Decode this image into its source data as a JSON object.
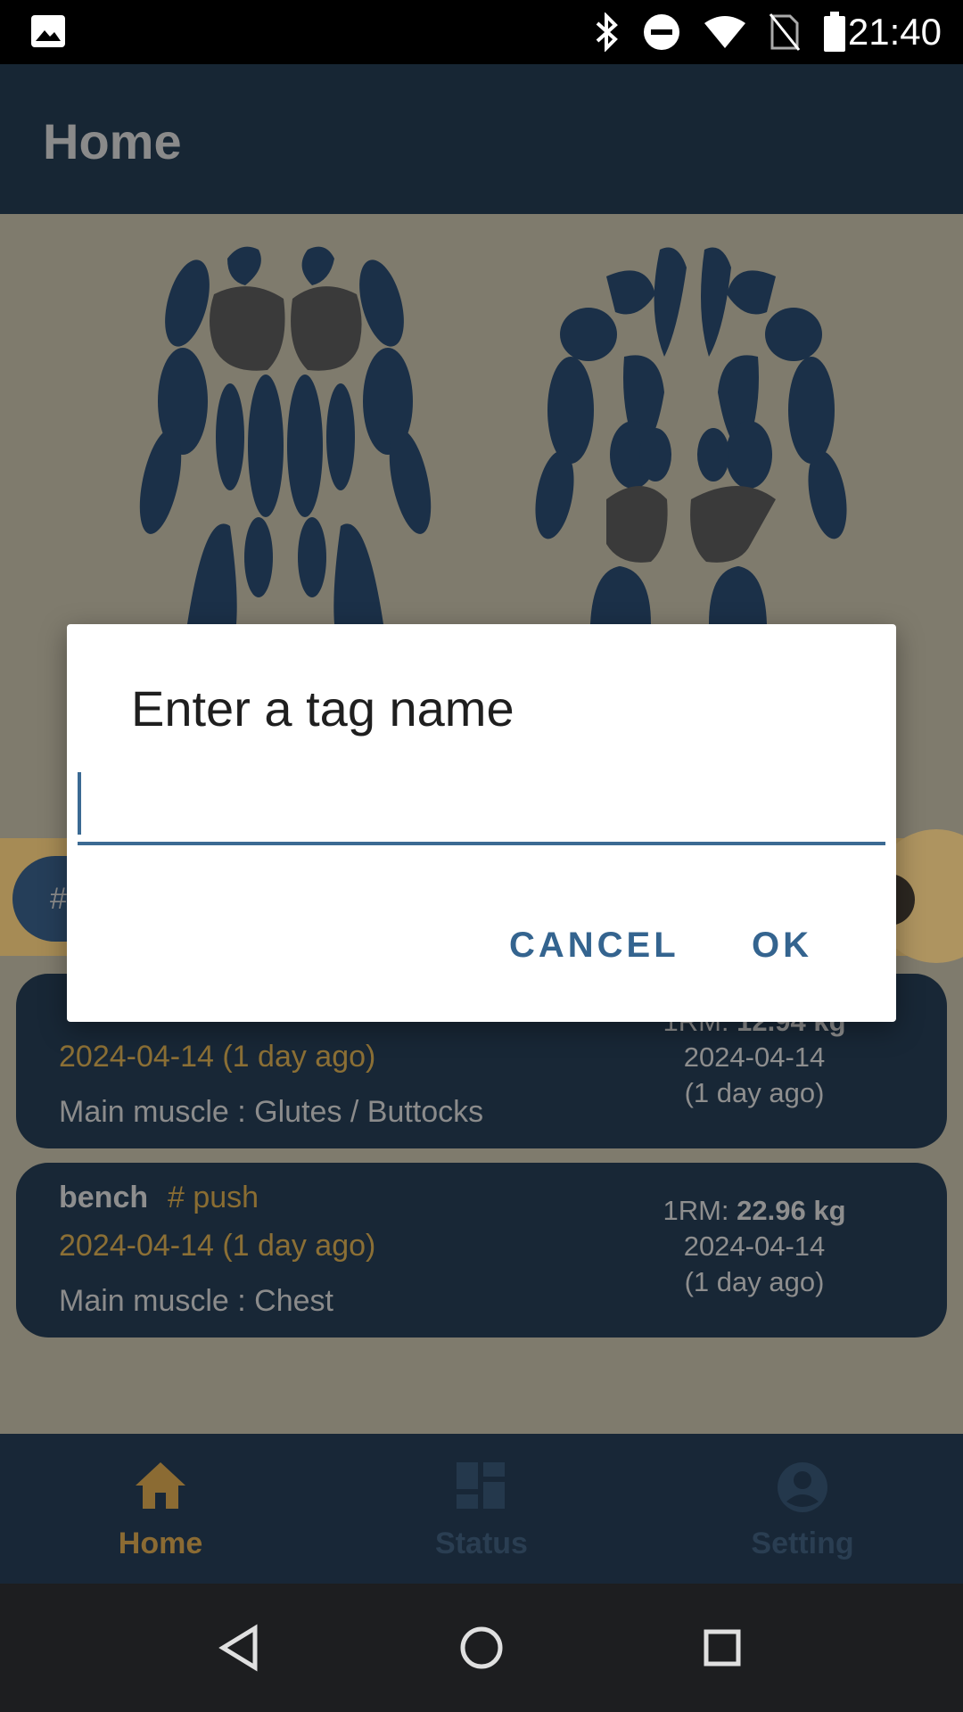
{
  "status_bar": {
    "time": "21:40"
  },
  "app_bar": {
    "title": "Home"
  },
  "filter": {
    "tag_chip_label": "#"
  },
  "cards": [
    {
      "name": "",
      "tag": "",
      "date": "2024-04-14 (1 day ago)",
      "muscle": "Main muscle : Glutes / Buttocks",
      "rm_prefix": "1RM: ",
      "rm_value": "12.94 kg",
      "rm_date": "2024-04-14",
      "rm_ago": "(1 day ago)"
    },
    {
      "name": "bench",
      "tag": "# push",
      "date": "2024-04-14 (1 day ago)",
      "muscle": "Main muscle : Chest",
      "rm_prefix": "1RM: ",
      "rm_value": "22.96 kg",
      "rm_date": "2024-04-14",
      "rm_ago": "(1 day ago)"
    }
  ],
  "bottom_nav": {
    "home": "Home",
    "status": "Status",
    "setting": "Setting"
  },
  "dialog": {
    "title": "Enter a tag name",
    "input_value": "",
    "cancel_label": "CANCEL",
    "ok_label": "OK"
  },
  "colors": {
    "accent": "#34648f",
    "app_bar": "#172634",
    "nav_active": "#8b6b33",
    "scrim": "#7f7b6d"
  }
}
